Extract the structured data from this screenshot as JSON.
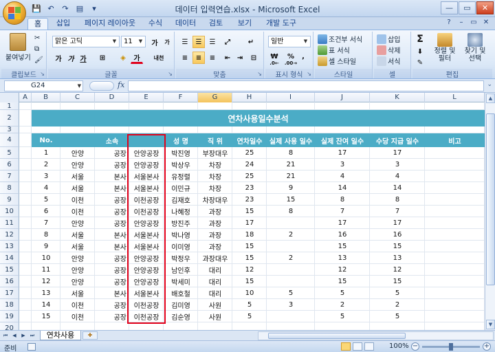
{
  "window": {
    "title": "데이터 입력연습.xlsx - Microsoft Excel",
    "controls": [
      "—",
      "▭",
      "✕"
    ]
  },
  "qat_icons": [
    "save-icon",
    "undo-icon",
    "redo-icon",
    "print-preview-icon",
    "customize-icon"
  ],
  "tabs": [
    "홈",
    "삽입",
    "페이지 레이아웃",
    "수식",
    "데이터",
    "검토",
    "보기",
    "개발 도구"
  ],
  "ribbon": {
    "clipboard": {
      "label": "클립보드",
      "paste": "붙여넣기"
    },
    "font": {
      "label": "글꼴",
      "font_name": "맑은 고딕",
      "font_size": "11",
      "grow": "가",
      "shrink": "가",
      "bold": "가",
      "italic": "가",
      "underline": "가",
      "font_color_glyph": "가",
      "phonetic": "내천"
    },
    "alignment": {
      "label": "맞춤"
    },
    "number": {
      "label": "표시 형식",
      "format": "일반",
      "currency": "₩",
      "percent": "%",
      "comma": ","
    },
    "styles": {
      "label": "스타일",
      "conditional": "조건부 서식",
      "table": "표 서식",
      "cell": "셀 스타일"
    },
    "cells": {
      "label": "셀",
      "insert": "삽입",
      "delete": "삭제",
      "format": "서식"
    },
    "editing": {
      "label": "편집",
      "sort": "정렬 및 필터",
      "find": "찾기 및 선택",
      "sum": "Σ"
    }
  },
  "formula_bar": {
    "name_box": "G24",
    "fx": "fx",
    "formula": ""
  },
  "columns": [
    "A",
    "B",
    "C",
    "D",
    "E",
    "F",
    "G",
    "H",
    "I",
    "J",
    "K",
    "L"
  ],
  "selected_column": "G",
  "rows": [
    1,
    2,
    3,
    4,
    5,
    6,
    7,
    8,
    9,
    10,
    11,
    12,
    13,
    14,
    15,
    16,
    17,
    18,
    19,
    20
  ],
  "sheet": {
    "title": "연차사용일수분석",
    "headers": [
      "No.",
      "소속",
      "성 명",
      "직 위",
      "연차일수",
      "실제 사용 일수",
      "실제 잔여 일수",
      "수당 지급 일수",
      "비고"
    ],
    "records": [
      [
        "1",
        "안양",
        "공장",
        "안양공장",
        "박진영",
        "부장대우",
        "25",
        "8",
        "17",
        "17",
        ""
      ],
      [
        "2",
        "안양",
        "공장",
        "안양공장",
        "박상우",
        "차장",
        "24",
        "21",
        "3",
        "3",
        ""
      ],
      [
        "3",
        "서울",
        "본사",
        "서울본사",
        "유정렬",
        "차장",
        "25",
        "21",
        "4",
        "4",
        ""
      ],
      [
        "4",
        "서울",
        "본사",
        "서울본사",
        "이민규",
        "차장",
        "23",
        "9",
        "14",
        "14",
        ""
      ],
      [
        "5",
        "이천",
        "공장",
        "이천공장",
        "김재호",
        "차장대우",
        "23",
        "15",
        "8",
        "8",
        ""
      ],
      [
        "6",
        "이천",
        "공장",
        "이천공장",
        "나혜정",
        "과장",
        "15",
        "8",
        "7",
        "7",
        ""
      ],
      [
        "7",
        "안양",
        "공장",
        "안양공장",
        "방진주",
        "과장",
        "17",
        "",
        "17",
        "17",
        ""
      ],
      [
        "8",
        "서울",
        "본사",
        "서울본사",
        "박나영",
        "과장",
        "18",
        "2",
        "16",
        "16",
        ""
      ],
      [
        "9",
        "서울",
        "본사",
        "서울본사",
        "이미영",
        "과장",
        "15",
        "",
        "15",
        "15",
        ""
      ],
      [
        "10",
        "안양",
        "공장",
        "안양공장",
        "박정우",
        "과장대우",
        "15",
        "2",
        "13",
        "13",
        ""
      ],
      [
        "11",
        "안양",
        "공장",
        "안양공장",
        "남인후",
        "대리",
        "12",
        "",
        "12",
        "12",
        ""
      ],
      [
        "12",
        "안양",
        "공장",
        "안양공장",
        "박세미",
        "대리",
        "15",
        "",
        "15",
        "15",
        ""
      ],
      [
        "13",
        "서울",
        "본사",
        "서울본사",
        "배호철",
        "대리",
        "10",
        "5",
        "5",
        "5",
        ""
      ],
      [
        "14",
        "이천",
        "공장",
        "이천공장",
        "김미영",
        "사원",
        "5",
        "3",
        "2",
        "2",
        ""
      ],
      [
        "15",
        "이천",
        "공장",
        "이천공장",
        "김순영",
        "사원",
        "5",
        "",
        "5",
        "5",
        ""
      ]
    ]
  },
  "sheet_tabs": {
    "active": "연차사용"
  },
  "status": {
    "ready": "준비",
    "zoom": "100%",
    "zoom_level_percent": 100
  },
  "colors": {
    "accent": "#4bacc6",
    "highlight_border": "#e2001a",
    "selected_header": "#f4c35c"
  }
}
